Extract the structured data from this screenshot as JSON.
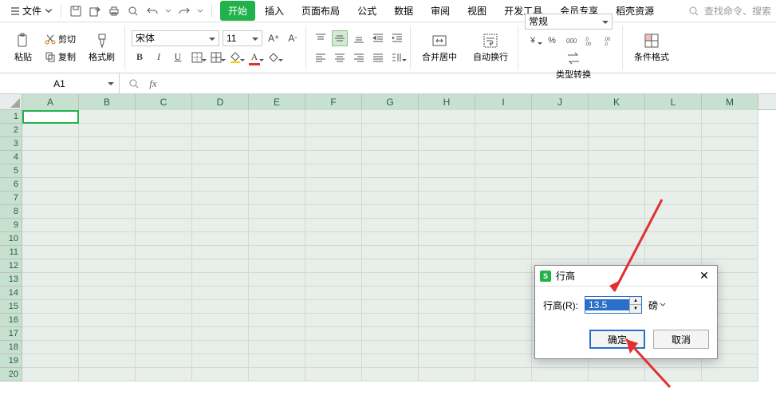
{
  "menubar": {
    "file": "文件",
    "tabs": [
      "开始",
      "插入",
      "页面布局",
      "公式",
      "数据",
      "审阅",
      "视图",
      "开发工具",
      "会员专享",
      "稻壳资源"
    ],
    "active_tab_index": 0,
    "search_placeholder": "查找命令、搜索"
  },
  "ribbon": {
    "paste_label": "粘贴",
    "cut_label": "剪切",
    "copy_label": "复制",
    "format_painter_label": "格式刷",
    "font_name": "宋体",
    "font_size": "11",
    "merge_label": "合并居中",
    "wrap_label": "自动换行",
    "number_format": "常规",
    "type_convert_label": "类型转换",
    "cond_format_label": "条件格式"
  },
  "formula_bar": {
    "cell_ref": "A1",
    "fx_label": "fx"
  },
  "grid": {
    "cols": [
      "A",
      "B",
      "C",
      "D",
      "E",
      "F",
      "G",
      "H",
      "I",
      "J",
      "K",
      "L",
      "M"
    ],
    "rows": [
      1,
      2,
      3,
      4,
      5,
      6,
      7,
      8,
      9,
      10,
      11,
      12,
      13,
      14,
      15,
      16,
      17,
      18,
      19,
      20
    ]
  },
  "dialog": {
    "title": "行高",
    "field_label": "行高(R):",
    "value": "13.5",
    "unit": "磅",
    "ok": "确定",
    "cancel": "取消"
  }
}
